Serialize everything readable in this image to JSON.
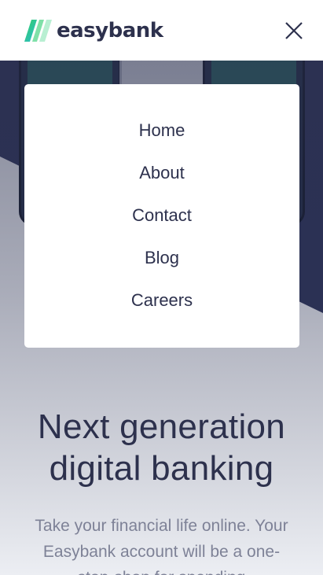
{
  "header": {
    "logo_text": "easybank",
    "icons": {
      "logo": "easybank-logo-mark",
      "close": "close-icon"
    },
    "colors": {
      "logo_green": "#31d35c",
      "logo_cyan": "#2bb7da",
      "text": "#2d314d"
    }
  },
  "menu": {
    "items": [
      {
        "label": "Home"
      },
      {
        "label": "About"
      },
      {
        "label": "Contact"
      },
      {
        "label": "Blog"
      },
      {
        "label": "Careers"
      }
    ]
  },
  "hero": {
    "title_line1": "Next generation",
    "title_line2": "digital banking",
    "description": "Take your financial life online. Your Easybank account will be a one-stop-shop for spending"
  }
}
